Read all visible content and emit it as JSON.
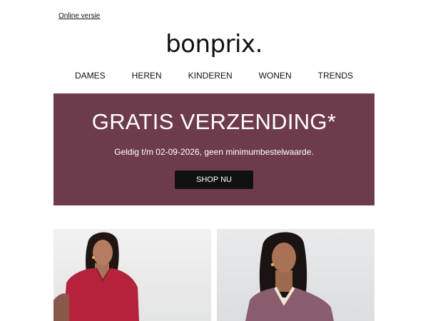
{
  "header": {
    "online_version": "Online versie",
    "logo_text": "bonprix."
  },
  "nav": {
    "items": [
      "DAMES",
      "HEREN",
      "KINDEREN",
      "WONEN",
      "TRENDS"
    ]
  },
  "promo": {
    "title": "GRATIS VERZENDING*",
    "subtitle": "Geldig t/m 02-09-2026, geen minimumbestelwaarde.",
    "cta": "SHOP NU",
    "background_color": "#6e3b4c"
  },
  "products": [
    {
      "image": "woman-red-satin-top-photo"
    },
    {
      "image": "woman-mauve-knit-top-photo"
    }
  ]
}
